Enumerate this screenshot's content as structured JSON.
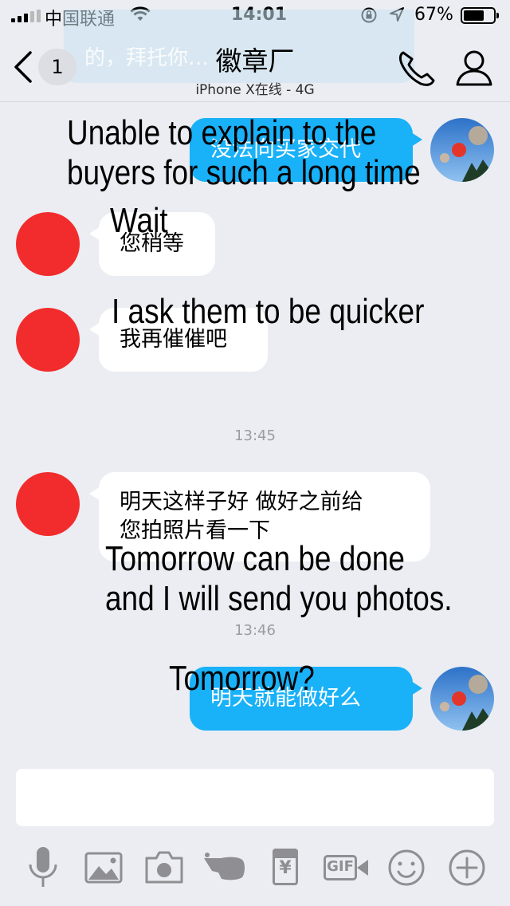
{
  "status_bar": {
    "carrier": "中国联通",
    "time": "14:01",
    "battery_percent_label": "67%",
    "battery_level": 0.67
  },
  "header": {
    "back_badge": "1",
    "title": "徽章厂",
    "subtitle": "iPhone X在线 - 4G",
    "faded_background_text": "的，拜托你…"
  },
  "messages": [
    {
      "side": "out",
      "text": "没法向买家交代",
      "overlay": [
        "Unable to explain to the",
        "buyers for such a long time"
      ]
    },
    {
      "side": "in",
      "text": "您稍等",
      "overlay": [
        "Wait"
      ]
    },
    {
      "side": "in",
      "text": "我再催催吧",
      "overlay": [
        "I ask them to be quicker"
      ]
    },
    {
      "type": "time",
      "text": "13:45"
    },
    {
      "side": "in",
      "text_lines": [
        "明天这样子好 做好之前给",
        "您拍照片看一下"
      ],
      "overlay": [
        "Tomorrow can be done",
        "and I will send you photos."
      ]
    },
    {
      "type": "time",
      "text": "13:46"
    },
    {
      "side": "out",
      "text": "明天就能做好么",
      "overlay": [
        "Tomorrow?"
      ]
    }
  ],
  "toolbar": {
    "icons": [
      "microphone-icon",
      "image-icon",
      "camera-icon",
      "poke-icon",
      "red-packet-icon",
      "gif-icon",
      "emoji-icon",
      "plus-icon"
    ],
    "gif_label": "GIF",
    "red_packet_label": "¥"
  },
  "colors": {
    "background": "#ebedf2",
    "outgoing_bubble": "#19b1f8",
    "incoming_bubble": "#ffffff",
    "avatar_red": "#f22c2c",
    "icon_gray": "#8e8e93"
  }
}
